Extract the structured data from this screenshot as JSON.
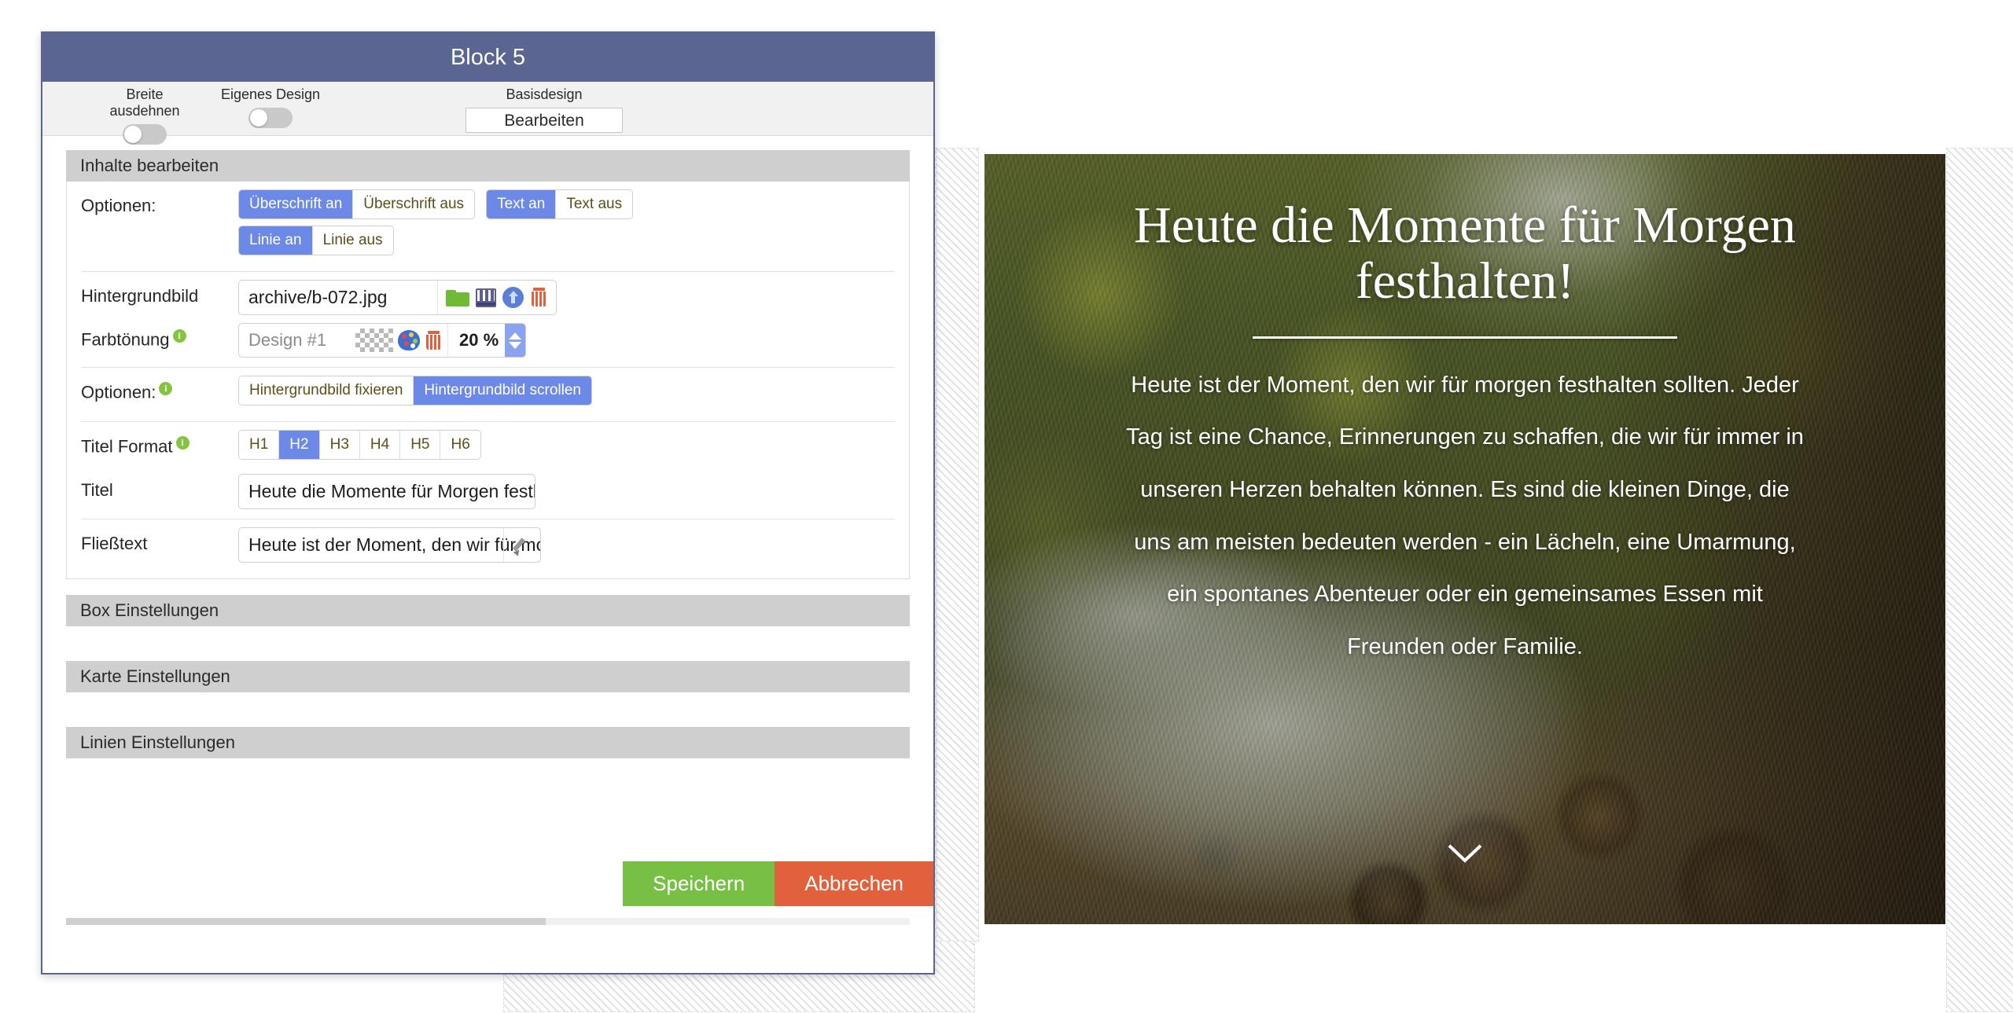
{
  "dialog": {
    "title": "Block 5",
    "toolbar": {
      "breite_label": "Breite ausdehnen",
      "breite_state": "off",
      "eigenes_label": "Eigenes Design",
      "eigenes_state": "off",
      "basisdesign_label": "Basisdesign",
      "basisdesign_button": "Bearbeiten"
    },
    "sections": {
      "inhalte": {
        "header": "Inhalte bearbeiten",
        "rows": {
          "optionen1": {
            "label": "Optionen:",
            "group_a": [
              {
                "label": "Überschrift an",
                "selected": true
              },
              {
                "label": "Überschrift aus",
                "selected": false
              }
            ],
            "group_b": [
              {
                "label": "Text an",
                "selected": true
              },
              {
                "label": "Text aus",
                "selected": false
              }
            ],
            "group_c": [
              {
                "label": "Linie an",
                "selected": true
              },
              {
                "label": "Linie aus",
                "selected": false
              }
            ]
          },
          "hintergrundbild": {
            "label": "Hintergrundbild",
            "value": "archive/b-072.jpg",
            "icons": [
              "folder-icon",
              "media-library-icon",
              "upload-icon",
              "trash-icon"
            ]
          },
          "farbtoenung": {
            "label": "Farbtönung",
            "info": "i",
            "value_placeholder": "Design #1",
            "percent": "20 %",
            "icons": [
              "transparency-checker-icon",
              "palette-icon",
              "trash-icon"
            ]
          },
          "optionen2": {
            "label": "Optionen:",
            "info": "i",
            "group": [
              {
                "label": "Hintergrundbild fixieren",
                "selected": false
              },
              {
                "label": "Hintergrundbild scrollen",
                "selected": true
              }
            ]
          },
          "titel_format": {
            "label": "Titel Format",
            "info": "i",
            "group": [
              {
                "label": "H1",
                "selected": false
              },
              {
                "label": "H2",
                "selected": true
              },
              {
                "label": "H3",
                "selected": false
              },
              {
                "label": "H4",
                "selected": false
              },
              {
                "label": "H5",
                "selected": false
              },
              {
                "label": "H6",
                "selected": false
              }
            ]
          },
          "titel": {
            "label": "Titel",
            "value": "Heute die Momente für Morgen festhalten!"
          },
          "fliesstext": {
            "label": "Fließtext",
            "value": "Heute ist der Moment, den wir für morg…",
            "icon": "pencil-icon"
          }
        }
      },
      "box": {
        "header": "Box Einstellungen"
      },
      "karte": {
        "header": "Karte Einstellungen"
      },
      "linien": {
        "header": "Linien Einstellungen"
      }
    },
    "footer": {
      "save_label": "Speichern",
      "cancel_label": "Abbrechen"
    }
  },
  "preview": {
    "title": "Heute die Momente für Morgen festhalten!",
    "body": "Heute ist der Moment, den wir für morgen festhalten sollten. Jeder Tag ist eine Chance, Erinnerungen zu schaffen, die wir für immer in unseren Herzen behalten können. Es sind die kleinen Dinge, die uns am meisten bedeuten werden - ein Lächeln, eine Umarmung, ein spontanes Abenteuer oder ein gemeinsames Essen mit Freunden oder Familie.",
    "chevron": "⌄",
    "overlay_opacity": "20 %"
  },
  "colors": {
    "titlebar": "#5b6591",
    "accent_selected": "#6d89e8",
    "section_header": "#cfcfcf",
    "save": "#78c044",
    "cancel": "#e1613c",
    "info_badge": "#85c441",
    "unselected_text": "#5e4f18"
  }
}
